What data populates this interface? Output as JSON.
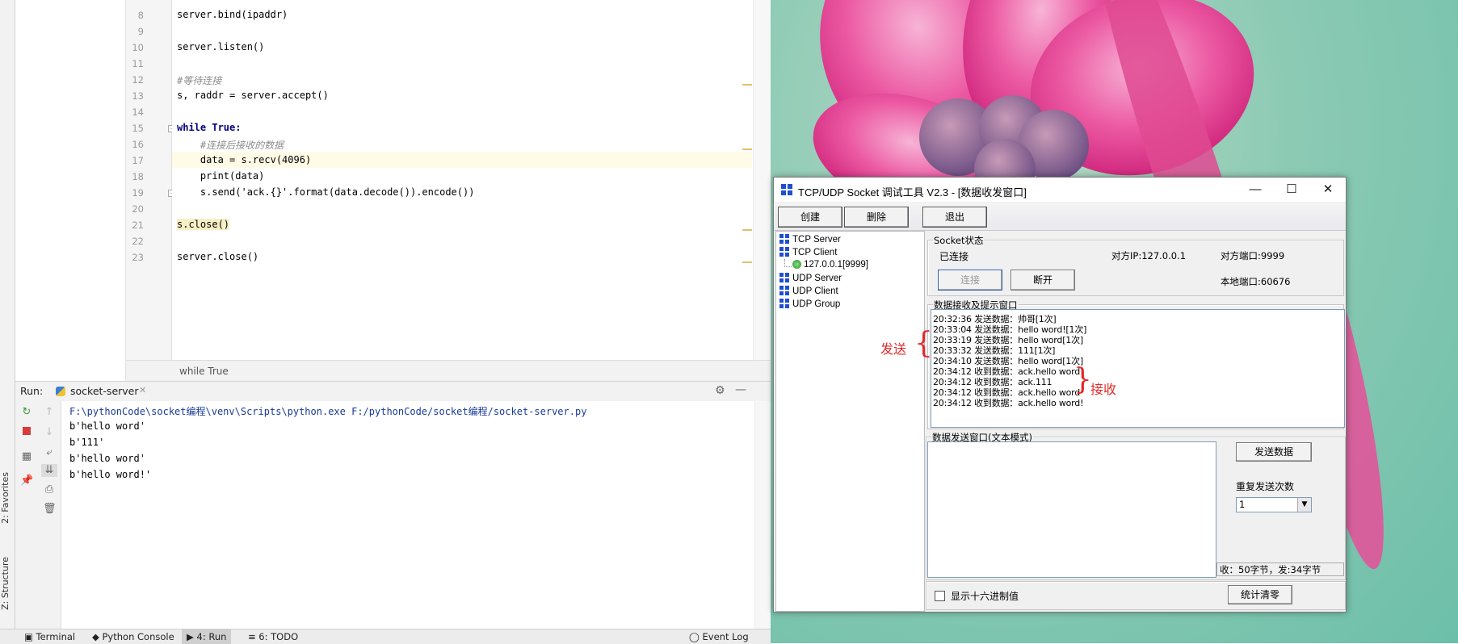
{
  "ide": {
    "side_tabs": {
      "favorites": "2: Favorites",
      "structure": "Z: Structure"
    },
    "code_lines": [
      {
        "n": "8",
        "text": "server.bind(ipaddr)"
      },
      {
        "n": "9",
        "text": ""
      },
      {
        "n": "10",
        "text": "server.listen()"
      },
      {
        "n": "11",
        "text": ""
      },
      {
        "n": "12",
        "text": "#等待连接"
      },
      {
        "n": "13",
        "text": "s, raddr = server.accept()"
      },
      {
        "n": "14",
        "text": ""
      },
      {
        "n": "15",
        "text": "while True:"
      },
      {
        "n": "16",
        "text": "    #连接后接收的数据"
      },
      {
        "n": "17",
        "text": "    data = s.recv(4096)"
      },
      {
        "n": "18",
        "text": "    print(data)"
      },
      {
        "n": "19",
        "text": "    s.send('ack.{}'.format(data.decode()).encode())"
      },
      {
        "n": "20",
        "text": ""
      },
      {
        "n": "21",
        "text": "s.close()"
      },
      {
        "n": "22",
        "text": ""
      },
      {
        "n": "23",
        "text": "server.close()"
      }
    ],
    "breadcrumb": "while True",
    "run": {
      "label": "Run:",
      "tab": "socket-server",
      "output": [
        "F:\\pythonCode\\socket编程\\venv\\Scripts\\python.exe F:/pythonCode/socket编程/socket-server.py",
        "b'hello word'",
        "b'111'",
        "b'hello word'",
        "b'hello word!'"
      ]
    },
    "bottom_tabs": [
      "Terminal",
      "Python Console",
      "4: Run",
      "6: TODO"
    ],
    "event_log": "Event Log"
  },
  "tool": {
    "title": "TCP/UDP Socket 调试工具 V2.3 - [数据收发窗口]",
    "toolbar": {
      "create": "创建",
      "delete": "删除",
      "exit": "退出"
    },
    "tree": {
      "tcp_server": "TCP Server",
      "tcp_client": "TCP Client",
      "client_node": "127.0.0.1[9999]",
      "udp_server": "UDP Server",
      "udp_client": "UDP Client",
      "udp_group": "UDP Group"
    },
    "socket_status": {
      "group_label": "Socket状态",
      "state": "已连接",
      "peer_ip": "对方IP:127.0.0.1",
      "peer_port": "对方端口:9999",
      "local_port": "本地端口:60676",
      "connect_btn": "连接",
      "disconnect_btn": "断开"
    },
    "recv": {
      "group_label": "数据接收及提示窗口",
      "lines": [
        "20:32:36 发送数据：帅哥[1次]",
        "20:33:04 发送数据：hello word![1次]",
        "20:33:19 发送数据：hello word[1次]",
        "20:33:32 发送数据：111[1次]",
        "20:34:10 发送数据：hello word[1次]",
        "20:34:12 收到数据：ack.hello word",
        "20:34:12 收到数据：ack.111",
        "20:34:12 收到数据：ack.hello word",
        "20:34:12 收到数据：ack.hello word!"
      ]
    },
    "send": {
      "group_label": "数据发送窗口(文本模式)",
      "send_btn": "发送数据",
      "repeat_label": "重复发送次数",
      "repeat_value": "1",
      "stats": "收：50字节，发:34字节",
      "hex_label": "显示十六进制值",
      "clear_btn": "统计清零"
    }
  },
  "annotations": {
    "send": "发送",
    "recv": "接收"
  },
  "colors": {
    "annotation_red": "#e32a2a",
    "tree_blue": "#1f4fd0",
    "keyword_navy": "#000080"
  }
}
